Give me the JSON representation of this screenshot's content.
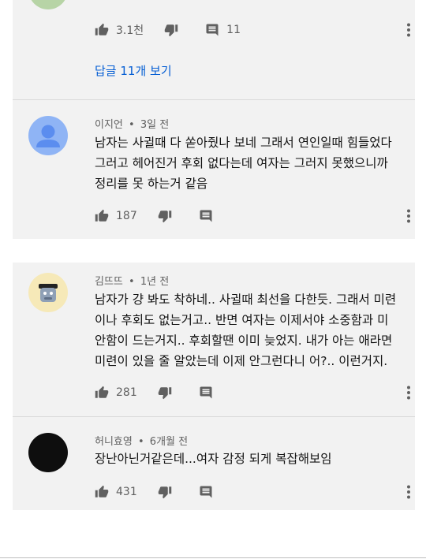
{
  "comments": [
    {
      "author": "",
      "time": "",
      "text": "",
      "likes": "3.1천",
      "reply_count": "11"
    },
    {
      "author": "이지언",
      "time": "3일 전",
      "text": "남자는 사귈때 다 쏟아줬나 보네 그래서 연인일때 힘들었다 그러고 헤어진거 후회 없다는데 여자는 그러지 못했으니까 정리를 못 하는거 같음",
      "likes": "187"
    },
    {
      "author": "김뜨뜨",
      "time": "1년 전",
      "text": "남자가 걍 봐도 착하네.. 사귈때 최선을 다한듯. 그래서 미련이나 후회도 없는거고.. 반면 여자는 이제서야 소중함과 미안함이 드는거지.. 후회할땐 이미 늦었지. 내가 아는 애라면 미련이 있을 줄 알았는데 이제 안그런다니 어?.. 이런거지.",
      "likes": "281"
    },
    {
      "author": "허니효영",
      "time": "6개월 전",
      "text": "장난아닌거같은데...여자 감정 되게 복잡해보임",
      "likes": "431"
    }
  ],
  "view_replies": "답글 11개 보기",
  "meta_separator": "•",
  "colors": {
    "panel_bg": "#f2f2f2",
    "link_blue": "#065fd4",
    "avatar_blue": "#5b8def",
    "avatar_dark": "#0e0e0e"
  }
}
